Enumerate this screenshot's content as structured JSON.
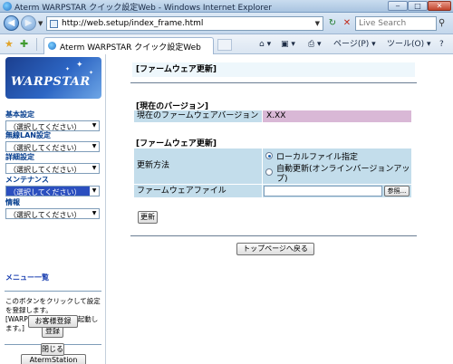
{
  "window": {
    "title": "Aterm WARPSTAR クイック設定Web - Windows Internet Explorer",
    "min": "‒",
    "max": "□",
    "close": "✕"
  },
  "addressbar": {
    "url": "http://web.setup/index_frame.html",
    "search_placeholder": "Live Search"
  },
  "tab": {
    "label": "Aterm WARPSTAR クイック設定Web"
  },
  "commandbar": {
    "page": "ページ(P) ▾",
    "tools": "ツール(O) ▾",
    "help": "?"
  },
  "sidebar": {
    "logo_text": "WARPSTAR",
    "sections": [
      {
        "title": "基本設定",
        "value": "（選択してください）"
      },
      {
        "title": "無線LAN設定",
        "value": "（選択してください）"
      },
      {
        "title": "詳細設定",
        "value": "（選択してください）"
      },
      {
        "title": "メンテナンス",
        "value": "（選択してください）"
      },
      {
        "title": "情報",
        "value": "（選択してください）"
      }
    ],
    "menu_list": "メニュー一覧",
    "note": "このボタンをクリックして設定を登録します。[WARPSTAR(親機)を再起動します。]",
    "register_button": "登録",
    "aterm_station_button": "AtermStation",
    "customer_register_button": "お客様登録",
    "close_button": "閉じる"
  },
  "main": {
    "heading": "[ファームウェア更新]",
    "current_version": {
      "title": "[現在のバージョン]",
      "label": "現在のファームウェアバージョン",
      "value": "X.XX"
    },
    "firmware_update": {
      "title": "[ファームウェア更新]",
      "method_label": "更新方法",
      "option_local": "ローカルファイル指定",
      "option_auto": "自動更新(オンラインバージョンアップ)",
      "file_label": "ファームウェアファイル",
      "browse_button": "参照...",
      "update_button": "更新"
    },
    "back_to_top_button": "トップページへ戻る"
  }
}
